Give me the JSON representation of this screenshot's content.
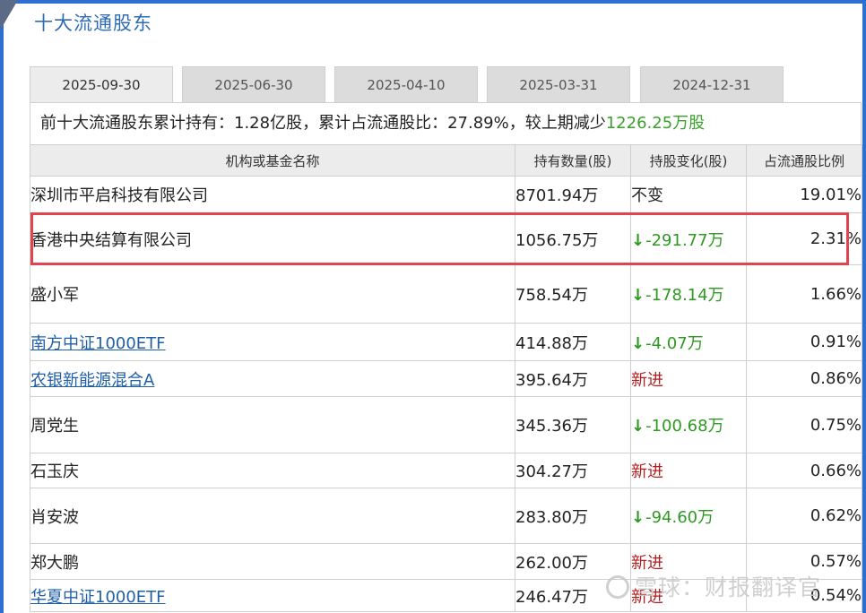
{
  "title": "十大流通股东",
  "tabs": [
    "2025-09-30",
    "2025-06-30",
    "2025-04-10",
    "2025-03-31",
    "2024-12-31"
  ],
  "active_tab_index": 0,
  "summary": {
    "prefix": "前十大流通股东累计持有：1.28亿股，累计占流通股比：27.89%，较上期减少",
    "change": "1226.25万股"
  },
  "columns": [
    "机构或基金名称",
    "持有数量(股)",
    "持股变化(股)",
    "占流通股比例"
  ],
  "rows": [
    {
      "name": "深圳市平启科技有限公司",
      "link": false,
      "qty": "8701.94万",
      "change": "不变",
      "change_type": "same",
      "pct": "19.01%"
    },
    {
      "name": "香港中央结算有限公司",
      "link": false,
      "qty": "1056.75万",
      "change": "-291.77万",
      "change_type": "down",
      "pct": "2.31%"
    },
    {
      "name": "盛小军",
      "link": false,
      "qty": "758.54万",
      "change": "-178.14万",
      "change_type": "down",
      "pct": "1.66%"
    },
    {
      "name": "南方中证1000ETF",
      "link": true,
      "qty": "414.88万",
      "change": "-4.07万",
      "change_type": "down",
      "pct": "0.91%"
    },
    {
      "name": "农银新能源混合A",
      "link": true,
      "qty": "395.64万",
      "change": "新进",
      "change_type": "new",
      "pct": "0.86%"
    },
    {
      "name": "周党生",
      "link": false,
      "qty": "345.36万",
      "change": "-100.68万",
      "change_type": "down",
      "pct": "0.75%"
    },
    {
      "name": "石玉庆",
      "link": false,
      "qty": "304.27万",
      "change": "新进",
      "change_type": "new",
      "pct": "0.66%"
    },
    {
      "name": "肖安波",
      "link": false,
      "qty": "283.80万",
      "change": "-94.60万",
      "change_type": "down",
      "pct": "0.62%"
    },
    {
      "name": "郑大鹏",
      "link": false,
      "qty": "262.00万",
      "change": "新进",
      "change_type": "new",
      "pct": "0.57%"
    },
    {
      "name": "华夏中证1000ETF",
      "link": true,
      "qty": "246.47万",
      "change": "新进",
      "change_type": "new",
      "pct": "0.54%"
    }
  ],
  "highlight_row_index": 1,
  "watermark": "雪球：财报翻译官",
  "colors": {
    "accent": "#2f6bb3",
    "down": "#2e9a21",
    "new": "#b02020",
    "highlight": "#e0454f"
  }
}
